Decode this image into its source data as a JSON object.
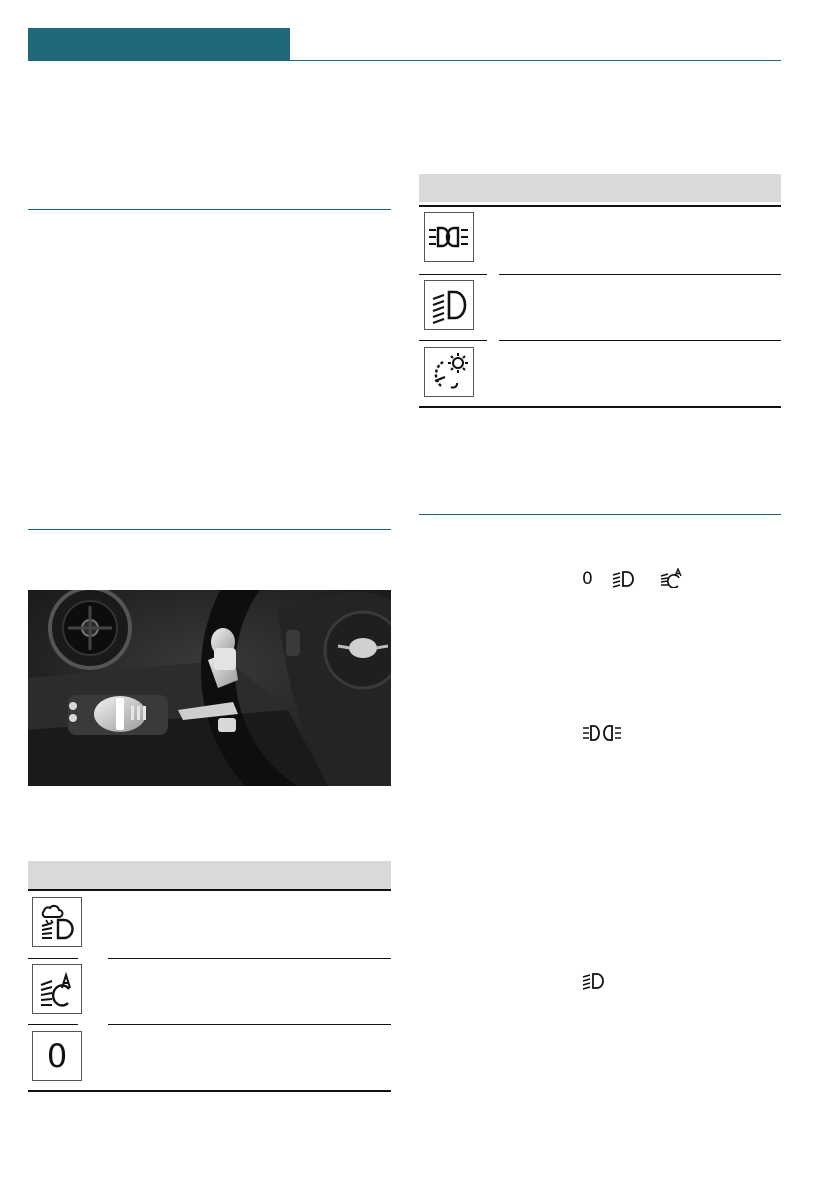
{
  "colors": {
    "accent": "#1e6a7b",
    "table_header": "#d9d9d9",
    "rule": "#111111"
  },
  "header": {
    "tab_color": "#1e6a7b"
  },
  "left_table": {
    "rows": [
      {
        "icon": "front-fog-lights-icon"
      },
      {
        "icon": "automatic-headlight-control-icon"
      },
      {
        "icon": "lights-off-zero-icon",
        "glyph": "0"
      }
    ]
  },
  "right_table": {
    "rows": [
      {
        "icon": "parking-lights-icon"
      },
      {
        "icon": "low-beams-icon"
      },
      {
        "icon": "instrument-lighting-icon"
      }
    ]
  },
  "inline_symbols": {
    "zero_glyph": "0",
    "row1": [
      "lights-off-zero-icon",
      "low-beams-icon",
      "automatic-headlight-control-icon"
    ],
    "row2": [
      "parking-lights-icon"
    ],
    "row3": [
      "low-beams-icon"
    ]
  },
  "photo": {
    "subject": "light-switch-and-steering-wheel-photo"
  }
}
